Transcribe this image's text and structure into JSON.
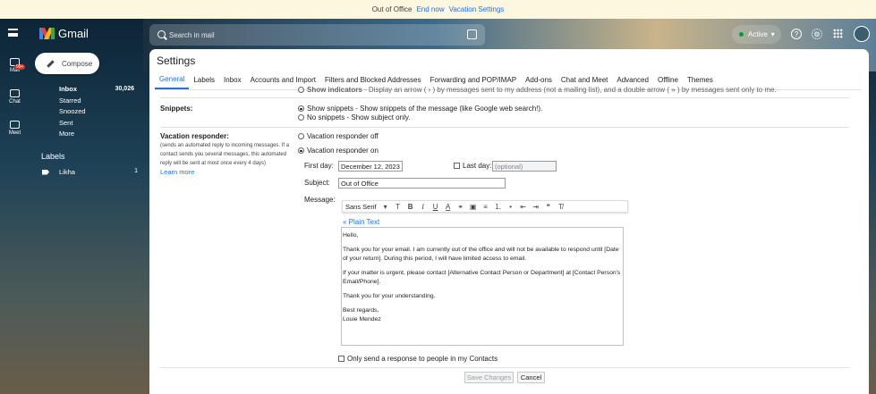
{
  "banner": {
    "text": "Out of Office",
    "end_link": "End now",
    "settings_link": "Vacation Settings"
  },
  "header": {
    "logo_text": "Gmail",
    "search_placeholder": "Search in mail",
    "status": "Active"
  },
  "rail": {
    "mail": "Mail",
    "chat": "Chat",
    "meet": "Meet",
    "badge": "99+"
  },
  "sidebar": {
    "compose": "Compose",
    "items": [
      {
        "label": "Inbox",
        "count": "30,026"
      },
      {
        "label": "Starred",
        "count": ""
      },
      {
        "label": "Snoozed",
        "count": ""
      },
      {
        "label": "Sent",
        "count": ""
      },
      {
        "label": "More",
        "count": ""
      }
    ],
    "labels_heading": "Labels",
    "labels": [
      {
        "label": "Likha",
        "count": "1"
      }
    ]
  },
  "settings": {
    "title": "Settings",
    "tabs": [
      "General",
      "Labels",
      "Inbox",
      "Accounts and Import",
      "Filters and Blocked Addresses",
      "Forwarding and POP/IMAP",
      "Add-ons",
      "Chat and Meet",
      "Advanced",
      "Offline",
      "Themes"
    ],
    "indicators": {
      "title": "Show indicators",
      "desc": " - Display an arrow ( › ) by messages sent to my address (not a mailing list), and a double arrow ( » ) by messages sent only to me."
    },
    "snippets": {
      "label": "Snippets:",
      "opt1_title": "Show snippets",
      "opt1_desc": " - Show snippets of the message (like Google web search!).",
      "opt2_title": "No snippets",
      "opt2_desc": " - Show subject only."
    },
    "vacation": {
      "label": "Vacation responder:",
      "desc": "(sends an automated reply to incoming messages. If a contact sends you several messages, this automated reply will be sent at most once every 4 days)",
      "learn_more": "Learn more",
      "off": "Vacation responder off",
      "on": "Vacation responder on",
      "first_day_label": "First day:",
      "first_day_value": "December 12, 2023",
      "last_day_label": "Last day:",
      "last_day_placeholder": "(optional)",
      "subject_label": "Subject:",
      "subject_value": "Out of Office",
      "message_label": "Message:",
      "font_name": "Sans Serif",
      "plain_text": "« Plain Text",
      "body": [
        "Hello,",
        "Thank you for your email. I am currently out of the office and will not be available to respond until [Date of your return]. During this period, I will have limited access to email.",
        "If your matter is urgent, please contact [Alternative Contact Person or Department] at [Contact Person's Email/Phone].",
        "Thank you for your understanding.",
        "Best regards,",
        "Louie Mendez"
      ],
      "contacts_only": "Only send a response to people in my Contacts"
    },
    "save": "Save Changes",
    "cancel": "Cancel"
  }
}
